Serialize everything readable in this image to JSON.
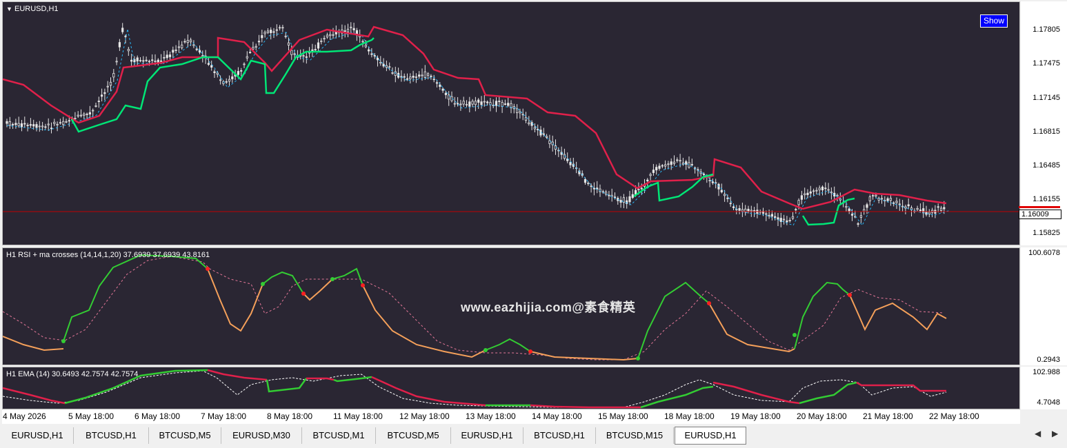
{
  "main": {
    "symbol_title": "EURUSD,H1",
    "show_button": "Show",
    "price_labels": [
      "1.17805",
      "1.17475",
      "1.17145",
      "1.16815",
      "1.16485",
      "1.16155",
      "1.15825"
    ],
    "current_price": "1.16009",
    "colors": {
      "bull_line": "#00e676",
      "bear_line": "#e0204a",
      "dashed_ma": "#29b6f6",
      "candle": "#e6e6e6",
      "price_line": "#c00000"
    }
  },
  "rsi": {
    "title": "H1 RSI + ma crosses (14,14,1,20) 37.6939 37.6939 43.8161",
    "ymax_label": "100.6078",
    "ymin_label": "0.2943",
    "colors": {
      "up": "#33cc33",
      "down": "#f5a05a",
      "ma": "#e67899",
      "dot_up": "#33cc33",
      "dot_down": "#ff2020"
    }
  },
  "ema": {
    "title": "H1 EMA (14) 30.6493 42.7574 42.7574",
    "ymax_label": "102.988",
    "ymin_label": "4.7048",
    "colors": {
      "up": "#33cc33",
      "down": "#e0204a",
      "ma": "#ffffff"
    }
  },
  "time_axis": [
    "4 May 2026",
    "5 May 18:00",
    "6 May 18:00",
    "7 May 18:00",
    "8 May 18:00",
    "11 May 18:00",
    "12 May 18:00",
    "13 May 18:00",
    "14 May 18:00",
    "15 May 18:00",
    "18 May 18:00",
    "19 May 18:00",
    "20 May 18:00",
    "21 May 18:00",
    "22 May 18:00"
  ],
  "tabs": [
    "EURUSD,H1",
    "BTCUSD,H1",
    "BTCUSD,M5",
    "EURUSD,M30",
    "BTCUSD,M1",
    "BTCUSD,M5",
    "EURUSD,H1",
    "BTCUSD,H1",
    "BTCUSD,M15",
    "EURUSD,H1"
  ],
  "active_tab": 9,
  "watermark": "www.eazhijia.com@素食精英"
}
